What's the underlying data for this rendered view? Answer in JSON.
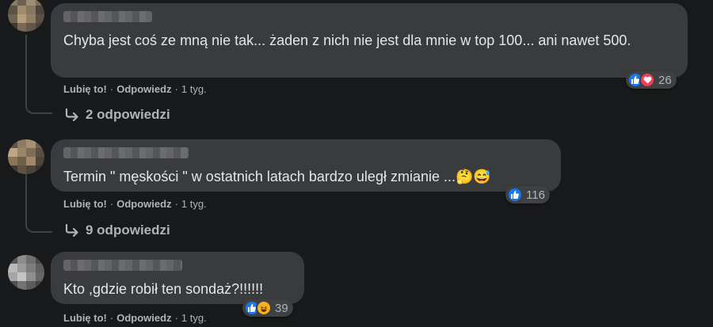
{
  "comments": [
    {
      "text": "Chyba jest coś ze mną nie tak... żaden z nich nie jest dla mnie w top 100... ani nawet 500.",
      "reactions": [
        "like",
        "love"
      ],
      "reaction_count": "26",
      "like_label": "Lubię to!",
      "reply_label": "Odpowiedz",
      "time": "1 tyg.",
      "replies_label": "2 odpowiedzi"
    },
    {
      "text": "Termin \" męskości \" w ostatnich latach bardzo uległ zmianie ...🤔😅",
      "reactions": [
        "like"
      ],
      "reaction_count": "116",
      "like_label": "Lubię to!",
      "reply_label": "Odpowiedz",
      "time": "1 tyg.",
      "replies_label": "9 odpowiedzi"
    },
    {
      "text": "Kto ,gdzie robił ten sondaż?!!!!!!",
      "reactions": [
        "like",
        "haha"
      ],
      "reaction_count": "39",
      "like_label": "Lubię to!",
      "reply_label": "Odpowiedz",
      "time": "1 tyg."
    }
  ],
  "colors": {
    "background": "#18191a",
    "bubble": "#3a3b3c",
    "like": "#1877f2",
    "love": "#f33e58",
    "haha": "#f7b125"
  }
}
